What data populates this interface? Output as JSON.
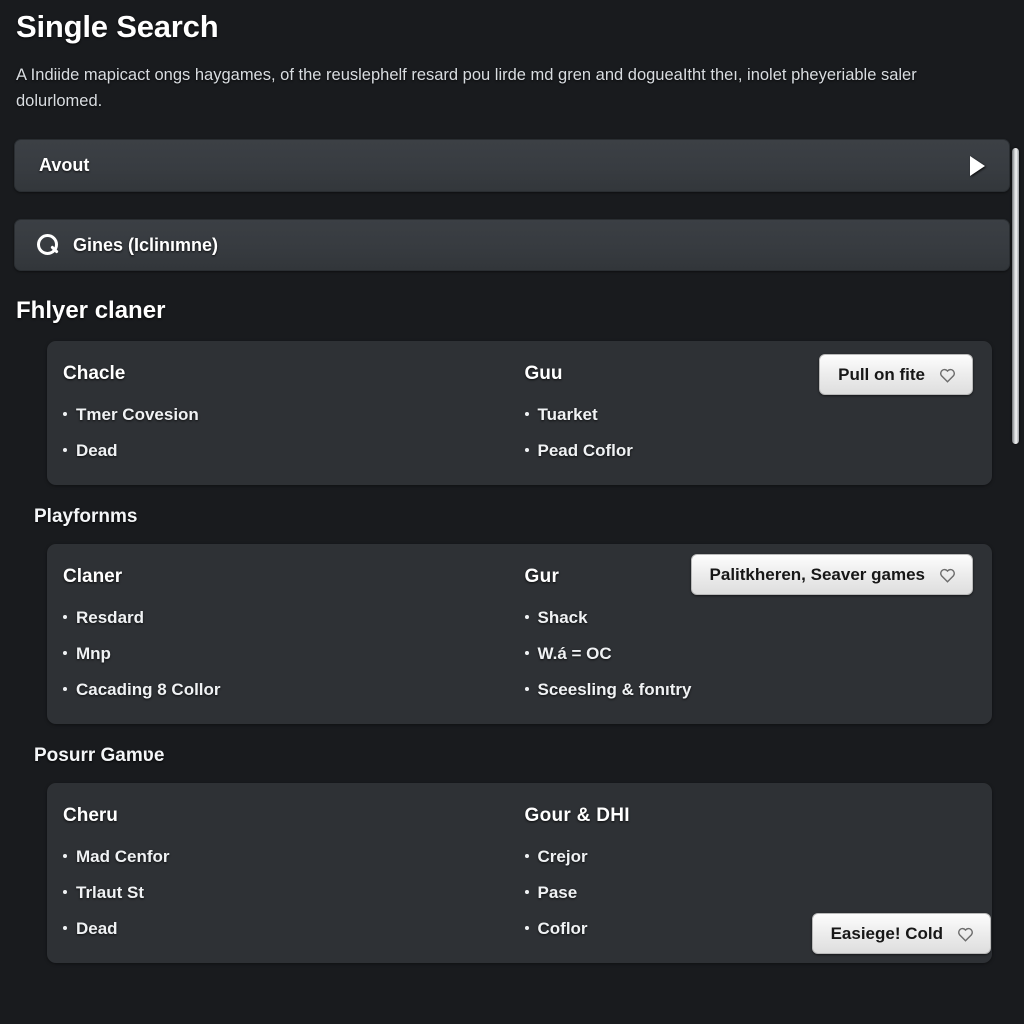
{
  "header": {
    "title": "Single Search",
    "description": "A Indiide mapicact ongs haygames, of the reuslephelf resard pou lirde md gren and dogueaItht theı, inolet pheyeriable saler dolurlomed."
  },
  "accordion": {
    "label": "Avout",
    "expand_icon": "triangle-right-icon"
  },
  "search": {
    "icon": "search-icon",
    "value": "Gines (Iclinımne)"
  },
  "scrollbar": {
    "orientation": "vertical"
  },
  "sections": [
    {
      "title": "Fhlyer claner",
      "title_size": "large",
      "columns": [
        {
          "head": "Chacle",
          "items": [
            {
              "text": "Tmer Covesion",
              "style": "normal"
            },
            {
              "text": "Dead",
              "style": "normal"
            }
          ]
        },
        {
          "head": "Guu",
          "items": [
            {
              "text": "Tuarket",
              "style": "link"
            },
            {
              "text": "Pead Coflor",
              "style": "normal"
            }
          ]
        }
      ],
      "button": {
        "label": "Pull on fite",
        "icon": "heart-icon"
      }
    },
    {
      "title": "Playfornms",
      "title_size": "small",
      "columns": [
        {
          "head": "Claner",
          "items": [
            {
              "text": "Resdard",
              "style": "normal"
            },
            {
              "text": "Mnp",
              "style": "muted"
            },
            {
              "text": "Cacading 8 Collor",
              "style": "normal"
            }
          ]
        },
        {
          "head": "Gur",
          "items": [
            {
              "text": "Shack",
              "style": "normal"
            },
            {
              "text": "W.á = OC",
              "style": "normal"
            },
            {
              "text": "Sceesling & fonıtry",
              "style": "normal"
            }
          ]
        }
      ],
      "button": {
        "label": "Palitkheren, Seaver games",
        "icon": "heart-icon"
      }
    },
    {
      "title": "Posurr Gamʋe",
      "title_size": "small",
      "columns": [
        {
          "head": "Cheru",
          "items": [
            {
              "text": "Mad Cenfor",
              "style": "normal"
            },
            {
              "text": "Trlaut St",
              "style": "link"
            },
            {
              "text": "Dead",
              "style": "normal"
            }
          ]
        },
        {
          "head": "Gour & DHI",
          "items": [
            {
              "text": "Crejor",
              "style": "link"
            },
            {
              "text": "Pase",
              "style": "link"
            },
            {
              "text": "Coflor",
              "style": "link"
            }
          ]
        }
      ],
      "button": {
        "label": "Easiege! Cold",
        "icon": "heart-icon"
      }
    }
  ],
  "colors": {
    "page_bg": "#191b1e",
    "card_bg": "#2e3135",
    "field_bg": "#383c41",
    "link": "#5b9ed8",
    "muted": "#7b8086",
    "button_bg": "#ededed",
    "button_text": "#171717"
  }
}
